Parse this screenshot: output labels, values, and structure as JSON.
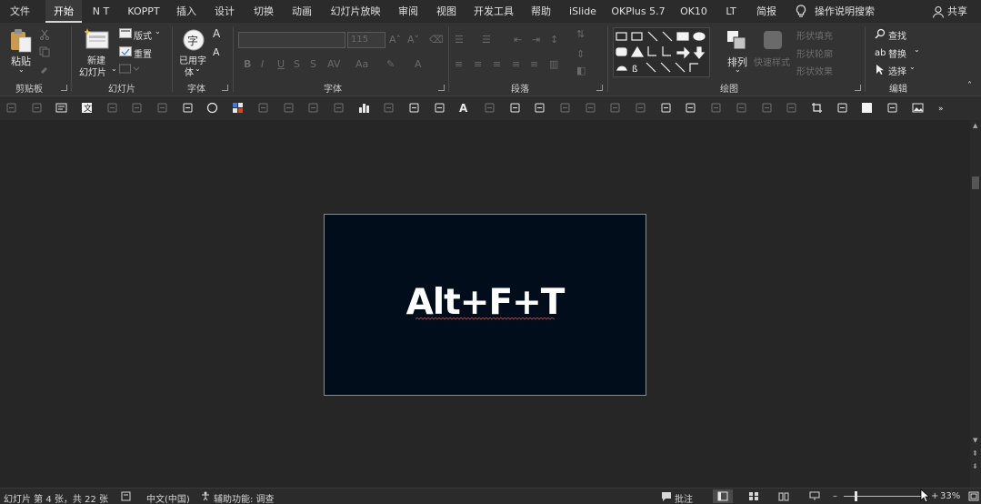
{
  "tabs": [
    "文件",
    "开始",
    "N T",
    "KOPPT",
    "插入",
    "设计",
    "切换",
    "动画",
    "幻灯片放映",
    "审阅",
    "视图",
    "开发工具",
    "帮助",
    "iSlide",
    "OKPlus 5.7",
    "OK10",
    "LT",
    "简报"
  ],
  "active_tab": "开始",
  "tell_me": "操作说明搜索",
  "share": "共享",
  "ribbon": {
    "clipboard": {
      "label": "剪贴板",
      "paste": "粘贴"
    },
    "slides": {
      "label": "幻灯片",
      "new_slide": "新建\n幻灯片",
      "new_slide_line1": "新建",
      "new_slide_line2": "幻灯片",
      "layout": "版式",
      "reset": "重置"
    },
    "font_set": {
      "label": "字体",
      "used_fonts_line1": "已用字",
      "used_fonts_line2": "体",
      "glyph": "字"
    },
    "font": {
      "label": "字体",
      "size_placeholder": "115",
      "bold": "B",
      "italic": "I",
      "underline": "U",
      "strike": "S",
      "aa": "Aa",
      "font_color": "A"
    },
    "paragraph": {
      "label": "段落"
    },
    "drawing": {
      "label": "绘图",
      "arrange": "排列",
      "quick_styles": "快速样式",
      "shape_fill": "形状填充",
      "shape_outline": "形状轮廓",
      "shape_effects": "形状效果"
    },
    "editing": {
      "label": "编辑",
      "find": "查找",
      "replace": "替换",
      "select": "选择"
    }
  },
  "slide": {
    "text": "Alt+F+T"
  },
  "status": {
    "slide_info": "幻灯片 第 4 张，共 22 张",
    "language": "中文(中国)",
    "accessibility": "辅助功能: 调查",
    "comments": "批注",
    "zoom": "33%"
  },
  "colors": {
    "accent": "#d24726",
    "slide_bg": "#020d1b",
    "ribbon_bg": "#333333",
    "app_bg": "#262626"
  }
}
